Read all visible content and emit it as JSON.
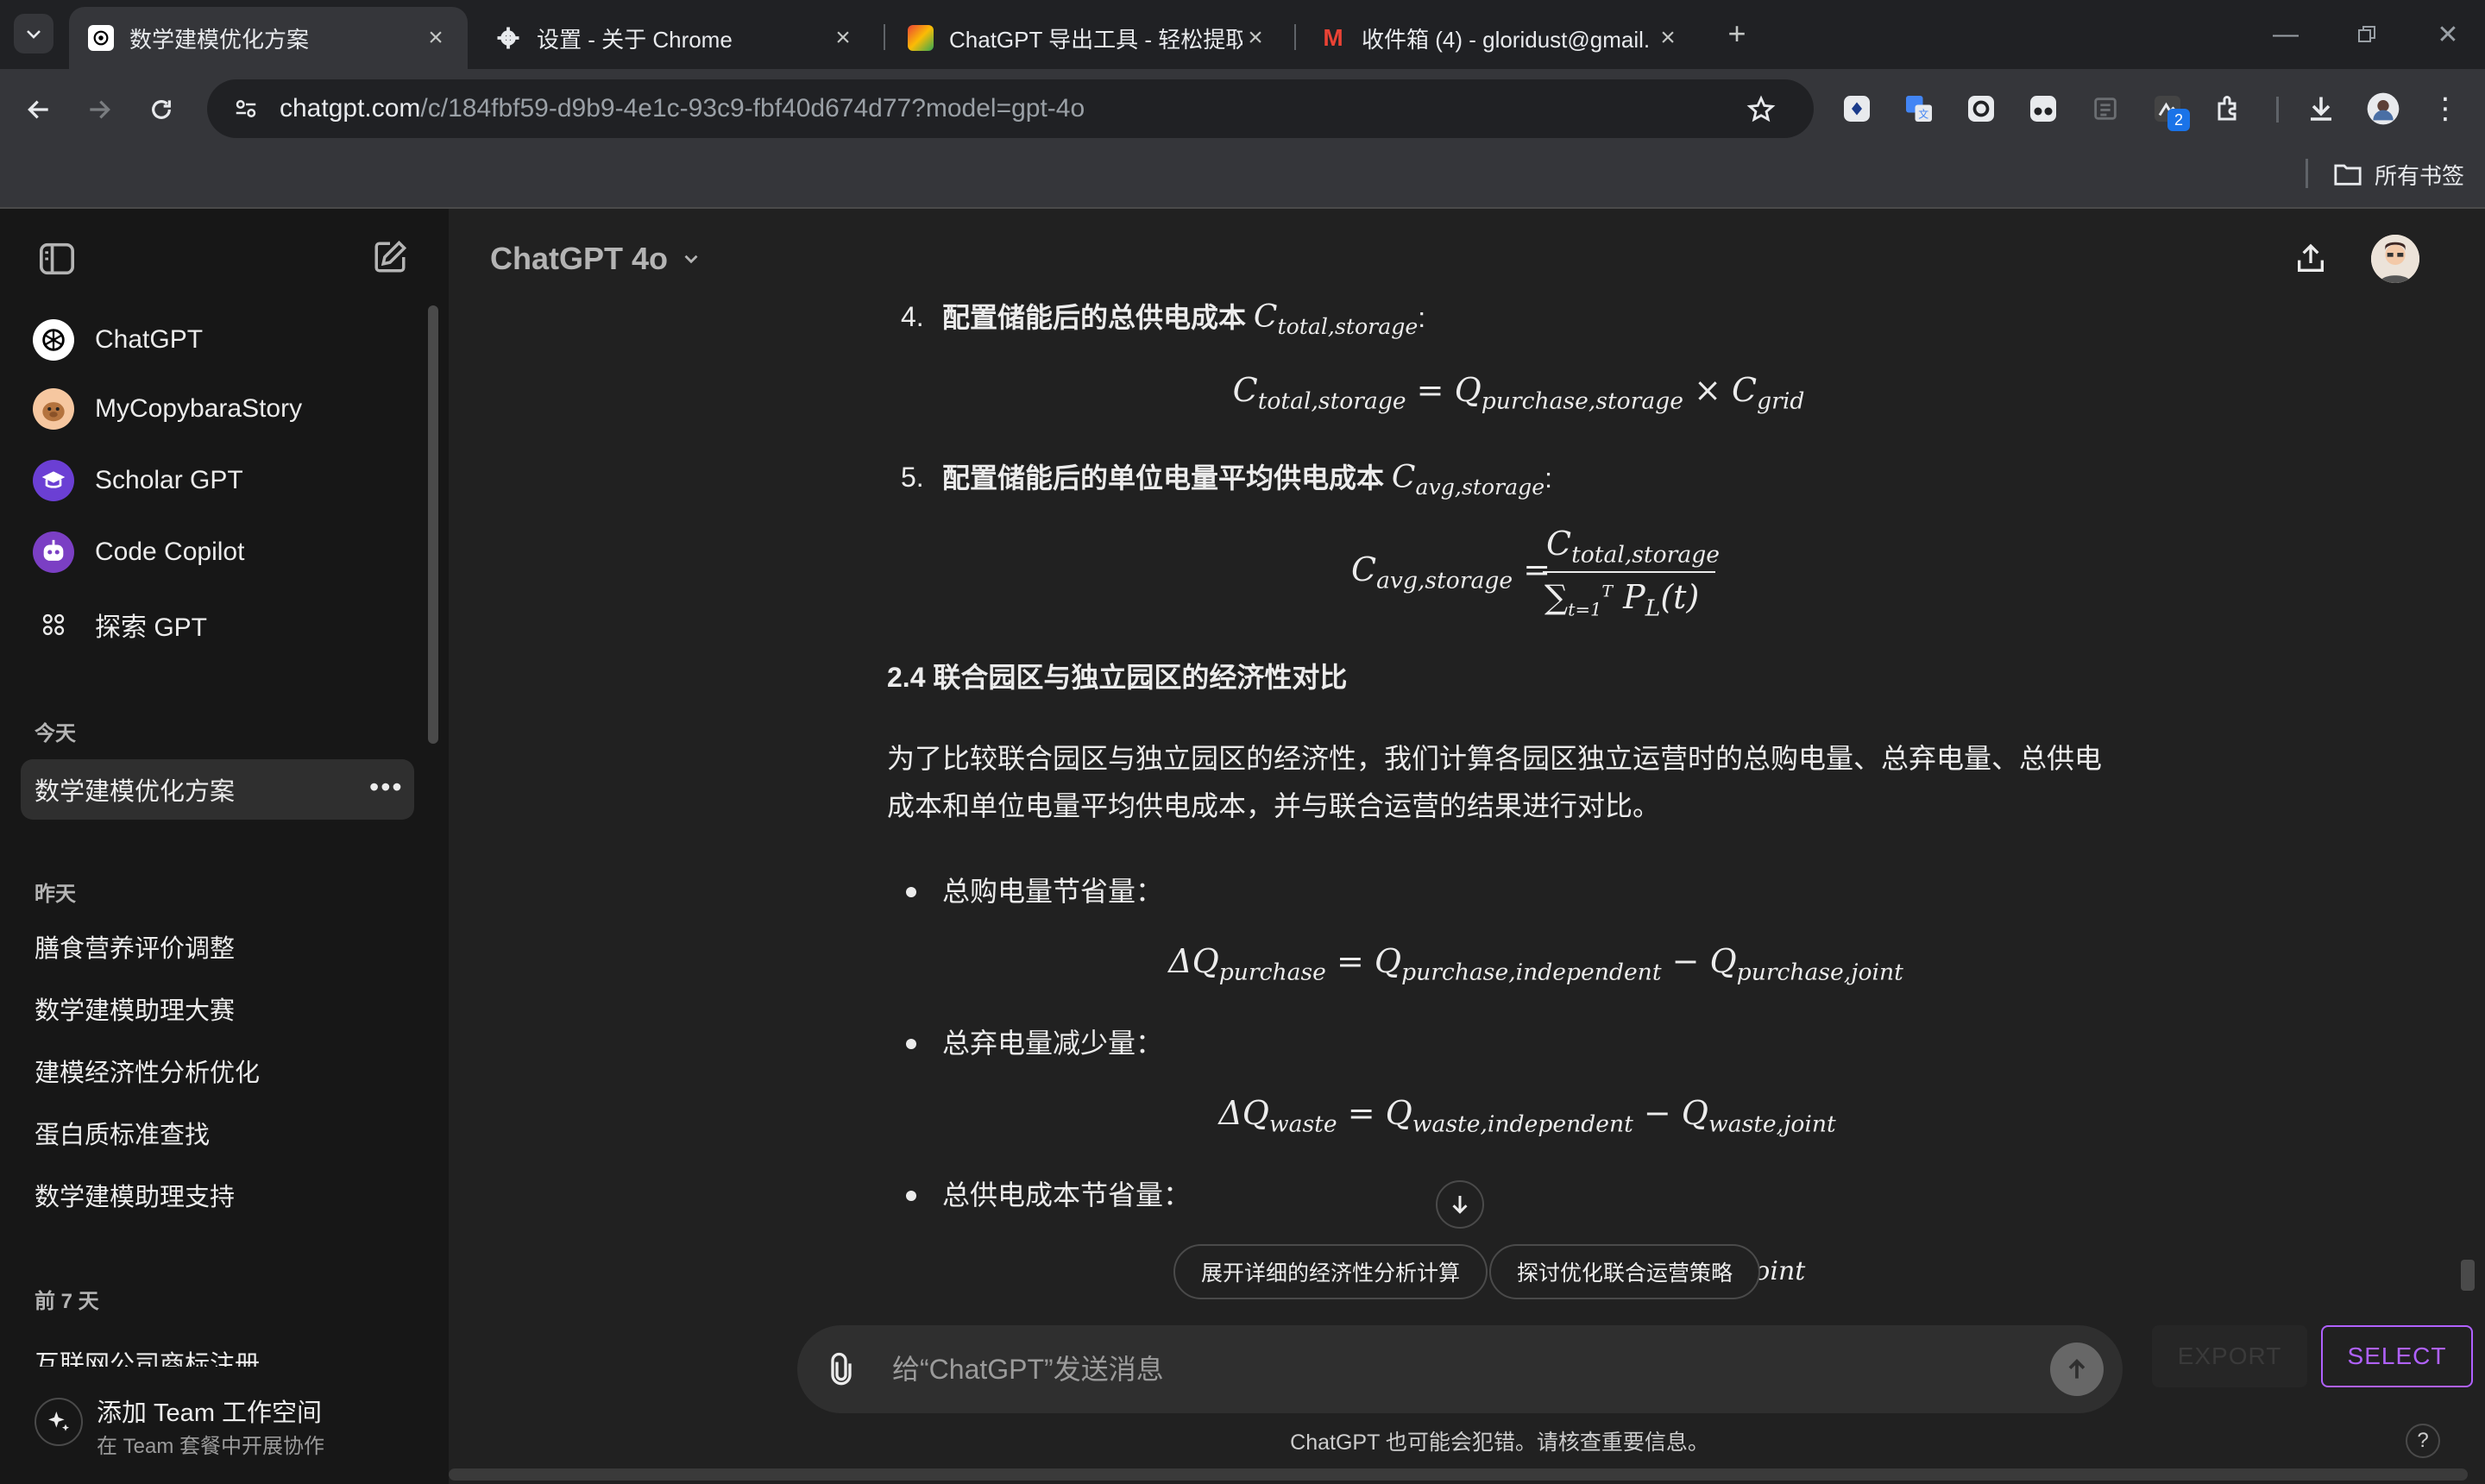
{
  "browser": {
    "tabs": [
      {
        "title": "数学建模优化方案",
        "active": true
      },
      {
        "title": "设置 - 关于 Chrome",
        "active": false
      },
      {
        "title": "ChatGPT 导出工具 - 轻松提取",
        "active": false
      },
      {
        "title": "收件箱 (4) - gloridust@gmail.",
        "active": false
      }
    ],
    "url_domain": "chatgpt.com",
    "url_path": "/c/184fbf59-d9b9-4e1c-93c9-fbf40d674d77?model=gpt-4o",
    "extension_badge": "2",
    "bookmarks_label": "所有书签"
  },
  "sidebar": {
    "gpts": [
      {
        "label": "ChatGPT",
        "icon": "openai-logo-icon"
      },
      {
        "label": "MyCopybaraStory",
        "icon": "capybara-avatar-icon"
      },
      {
        "label": "Scholar GPT",
        "icon": "scholar-gpt-icon"
      },
      {
        "label": "Code Copilot",
        "icon": "code-copilot-icon"
      },
      {
        "label": "探索 GPT",
        "icon": "explore-grid-icon"
      }
    ],
    "today_heading": "今天",
    "today": [
      {
        "label": "数学建模优化方案",
        "active": true
      }
    ],
    "yesterday_heading": "昨天",
    "yesterday": [
      "膳食营养评价调整",
      "数学建模助理大赛",
      "建模经济性分析优化",
      "蛋白质标准查找",
      "数学建模助理支持"
    ],
    "week_heading": "前 7 天",
    "week": [
      "互联网公司商标注册"
    ],
    "team": {
      "title": "添加 Team 工作空间",
      "subtitle": "在 Team 套餐中开展协作"
    }
  },
  "header": {
    "model": "ChatGPT 4o"
  },
  "content": {
    "item4": {
      "num": "4.",
      "label": "配置储能后的总供电成本"
    },
    "item5": {
      "num": "5.",
      "label": "配置储能后的单位电量平均供电成本"
    },
    "section_title": "2.4 联合园区与独立园区的经济性对比",
    "paragraph_line1": "为了比较联合园区与独立园区的经济性，我们计算各园区独立运营时的总购电量、总弃电量、总供电",
    "paragraph_line2": "成本和单位电量平均供电成本，并与联合运营的结果进行对比。",
    "bullets": [
      "总购电量节省量：",
      "总弃电量减少量：",
      "总供电成本节省量："
    ]
  },
  "suggestions": [
    "展开详细的经济性分析计算",
    "探讨优化联合运营策略"
  ],
  "composer": {
    "placeholder": "给“ChatGPT”发送消息"
  },
  "footer": {
    "disclaimer": "ChatGPT 也可能会犯错。请核查重要信息。",
    "help": "?"
  },
  "export_tool": {
    "export_label": "EXPORT",
    "select_label": "SELECT",
    "accent": "#b061ff"
  }
}
